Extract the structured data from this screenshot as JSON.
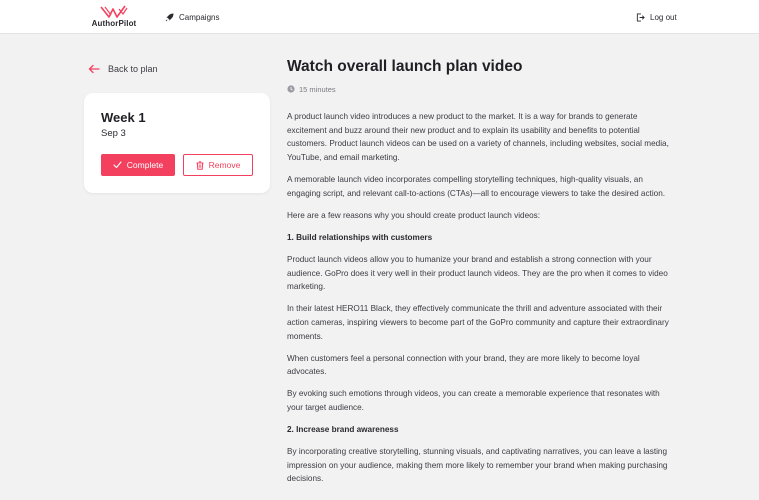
{
  "header": {
    "logo_text": "AuthorPilot",
    "nav_campaigns": "Campaigns",
    "logout": "Log out"
  },
  "sidebar": {
    "back_label": "Back to plan",
    "week_title": "Week 1",
    "week_date": "Sep 3",
    "complete_label": "Complete",
    "remove_label": "Remove"
  },
  "main": {
    "title": "Watch overall launch plan video",
    "duration": "15 minutes",
    "paragraphs": [
      "A product launch video introduces a new product to the market. It is a way for brands to generate excitement and buzz around their new product and to explain its usability and benefits to potential customers. Product launch videos can be used on a variety of channels, including websites, social media, YouTube, and email marketing.",
      "A memorable launch video incorporates compelling storytelling techniques, high-quality visuals, an engaging script, and relevant call-to-actions (CTAs)—all to encourage viewers to take the desired action.",
      "Here are a few reasons why you should create product launch videos:",
      "1. Build relationships with customers",
      "Product launch videos allow you to humanize your brand and establish a strong connection with your audience. GoPro does it very well in their product launch videos. They are the pro when it comes to video marketing.",
      "In their latest HERO11 Black, they effectively communicate the thrill and adventure associated with their action cameras, inspiring viewers to become part of the GoPro community and capture their extraordinary moments.",
      "When customers feel a personal connection with your brand, they are more likely to become loyal advocates.",
      "By evoking such emotions through videos, you can create a memorable experience that resonates with your target audience.",
      "2. Increase brand awareness",
      "By incorporating creative storytelling, stunning visuals, and captivating narratives, you can leave a lasting impression on your audience, making them more likely to remember your brand when making purchasing decisions."
    ]
  },
  "icons": {
    "logo": "authorpilot-logo-icon",
    "campaigns": "rocket-icon",
    "logout": "logout-icon",
    "back": "arrow-left-icon",
    "complete": "check-icon",
    "remove": "trash-icon",
    "duration": "clock-icon"
  },
  "colors": {
    "accent": "#f2405e",
    "background": "#f2f2f3",
    "card": "#ffffff",
    "text": "#3c3c42"
  }
}
